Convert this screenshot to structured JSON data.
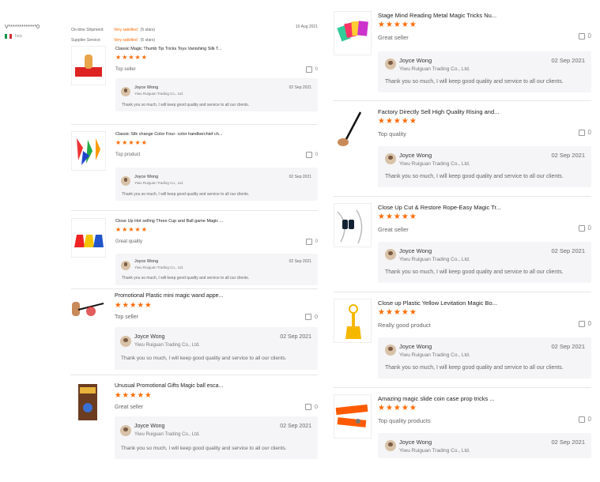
{
  "buyer": {
    "name": "V*************0",
    "country": "Italy"
  },
  "ratings": {
    "shipment_label": "On-time Shipment:",
    "shipment_value": "Very satisfied",
    "shipment_count": "(5 stars)",
    "service_label": "Supplier Service:",
    "service_value": "Very satisfied",
    "service_count": "(5 stars)",
    "date": "10 Aug 2021"
  },
  "stars": "★★★★★",
  "reply": {
    "name": "Joyce Wong",
    "company": "Yiwu Ruiguan Trading Co., Ltd.",
    "date": "02 Sep 2021",
    "message": "Thank you so much, I will keep good quality and service to all our clients."
  },
  "reviews": [
    {
      "title": "Classic Magic Thumb Tip Tricks Toys Vanishing Silk T...",
      "tag": "Top seller",
      "likes": "0"
    },
    {
      "title": "Classic Silk change Color Four- color handkerchief ch...",
      "tag": "Top product",
      "likes": "0"
    },
    {
      "title": "Close Up Hot selling Three Cup and Ball game Magic ...",
      "tag": "Great quality",
      "likes": "0"
    },
    {
      "title": "Promotional Plastic mini magic wand appe...",
      "tag": "Top seller",
      "likes": "0"
    },
    {
      "title": "Unusual Promotional Gifts Magic ball esca...",
      "tag": "Great seller",
      "likes": "0"
    },
    {
      "title": "Stage Mind Reading Metal Magic Tricks Nu...",
      "tag": "Great seller",
      "likes": "0"
    },
    {
      "title": "Factory Directly Sell High Quality Rising and...",
      "tag": "Top quality",
      "likes": "0"
    },
    {
      "title": "Close Up Cut & Restore Rope-Easy Magic Tr...",
      "tag": "Great seller",
      "likes": "0"
    },
    {
      "title": "Close up Plastic Yellow Levitation Magic Bo...",
      "tag": "Really good product",
      "likes": "0"
    },
    {
      "title": "Amazing magic slide coin case prop tricks ...",
      "tag": "Top quality products",
      "likes": "0"
    }
  ],
  "colors": {
    "accent": "#ff6a00",
    "reply_bg": "#f5f5f7"
  }
}
